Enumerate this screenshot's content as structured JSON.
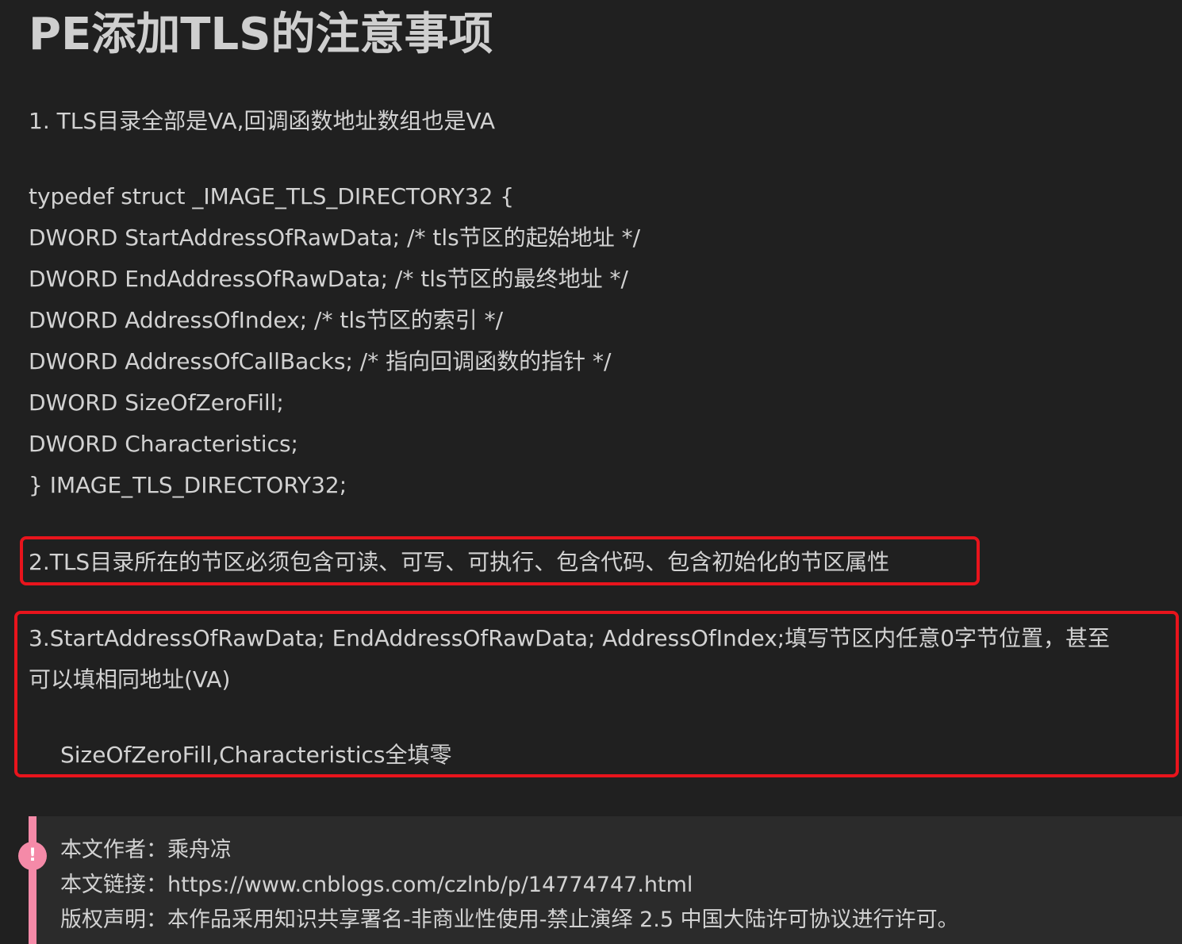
{
  "title": "PE添加TLS的注意事项",
  "point1": "1. TLS目录全部是VA,回调函数地址数组也是VA",
  "code": [
    "typedef struct _IMAGE_TLS_DIRECTORY32 {",
    "DWORD StartAddressOfRawData; /* tls节区的起始地址 */",
    "DWORD EndAddressOfRawData; /* tls节区的最终地址 */",
    "DWORD AddressOfIndex; /* tls节区的索引 */",
    "DWORD AddressOfCallBacks; /* 指向回调函数的指针 */",
    "DWORD SizeOfZeroFill;",
    "DWORD Characteristics;",
    "} IMAGE_TLS_DIRECTORY32;"
  ],
  "point2": "2.TLS目录所在的节区必须包含可读、可写、可执行、包含代码、包含初始化的节区属性",
  "point3": {
    "line1": "3.StartAddressOfRawData; EndAddressOfRawData; AddressOfIndex;填写节区内任意0字节位置，甚至",
    "line2": "可以填相同地址(VA)",
    "line3": "SizeOfZeroFill,Characteristics全填零"
  },
  "notice": {
    "icon": "exclamation-icon",
    "author": "本文作者：乘舟凉",
    "link": "本文链接：https://www.cnblogs.com/czlnb/p/14774747.html",
    "license": "版权声明：本作品采用知识共享署名-非商业性使用-禁止演绎 2.5 中国大陆许可协议进行许可。"
  },
  "colors": {
    "background": "#202020",
    "highlight_border": "#e8141c",
    "notice_accent": "#f58aa8",
    "notice_background": "#2b2b2b"
  }
}
